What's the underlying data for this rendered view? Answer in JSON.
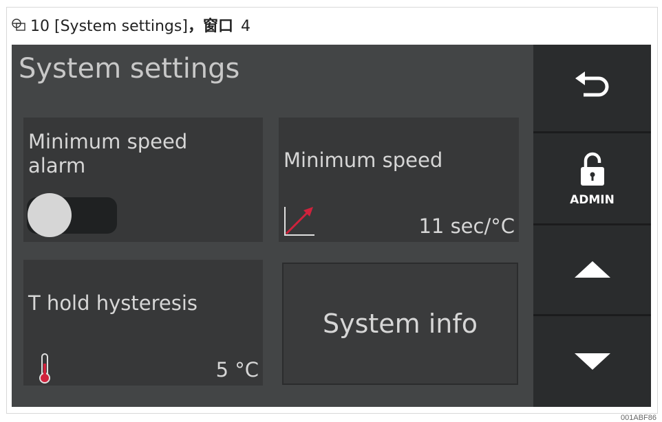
{
  "caption": {
    "figure_number": "10",
    "title": "[System settings]",
    "suffix": "，窗口",
    "window_number": "4"
  },
  "screen": {
    "title": "System settings",
    "tiles": {
      "min_speed_alarm": {
        "label": "Minimum speed alarm",
        "toggle_on": false
      },
      "min_speed": {
        "label": "Minimum speed",
        "value": "11 sec/°C",
        "icon": "rising-slope-icon"
      },
      "t_hold_hysteresis": {
        "label": "T hold hysteresis",
        "value": "5 °C",
        "icon": "thermometer-icon"
      },
      "system_info": {
        "label": "System info"
      }
    },
    "sidebar": {
      "back_icon": "back-arrow-icon",
      "admin_label": "ADMIN",
      "admin_icon": "unlocked-padlock-icon",
      "up_icon": "triangle-up-icon",
      "down_icon": "triangle-down-icon"
    }
  },
  "footer_code": "001ABF86",
  "colors": {
    "screen_bg": "#434546",
    "tile_bg": "#373839",
    "sidebar_bg": "#2a2c2d",
    "accent_red": "#d0223c",
    "text": "#d6d6d6"
  }
}
